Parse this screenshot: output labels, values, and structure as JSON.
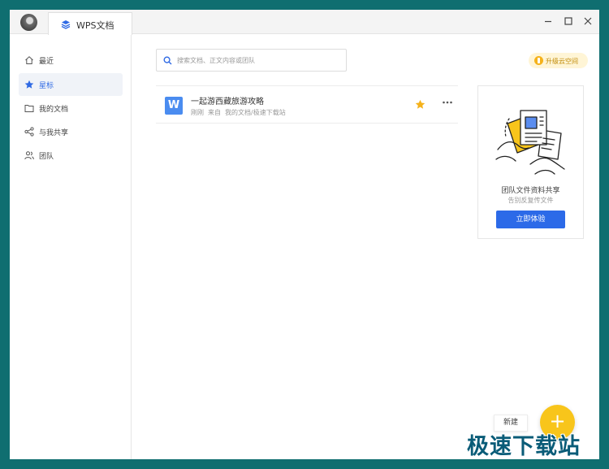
{
  "colors": {
    "accent": "#2c6ae8",
    "star": "#f5b21b",
    "fab": "#f8c51b",
    "frame": "#0f6e70"
  },
  "titlebar": {
    "tab_label": "WPS文档",
    "tab_icon": "layers-icon",
    "controls": [
      "minimize-icon",
      "maximize-icon",
      "close-icon"
    ]
  },
  "sidebar": {
    "items": [
      {
        "label": "最近",
        "icon": "clock-icon",
        "active": false
      },
      {
        "label": "星标",
        "icon": "star-icon",
        "active": true
      },
      {
        "label": "我的文档",
        "icon": "folder-icon",
        "active": false
      },
      {
        "label": "与我共享",
        "icon": "share-icon",
        "active": false
      },
      {
        "label": "团队",
        "icon": "team-icon",
        "active": false
      }
    ]
  },
  "search": {
    "placeholder": "搜索文档、正文内容或团队",
    "value": ""
  },
  "upgrade": {
    "label": "升级云空间"
  },
  "documents": [
    {
      "title": "一起游西藏旅游攻略",
      "time": "刚刚",
      "source_prefix": "来自",
      "source": "我的文档/极速下载站",
      "starred": true,
      "type_letter": "W"
    }
  ],
  "promo": {
    "title": "团队文件资料共享",
    "subtitle": "告别反复传文件",
    "button": "立即体验"
  },
  "fab": {
    "label": "新建",
    "symbol": "+"
  },
  "watermark": "极速下载站"
}
